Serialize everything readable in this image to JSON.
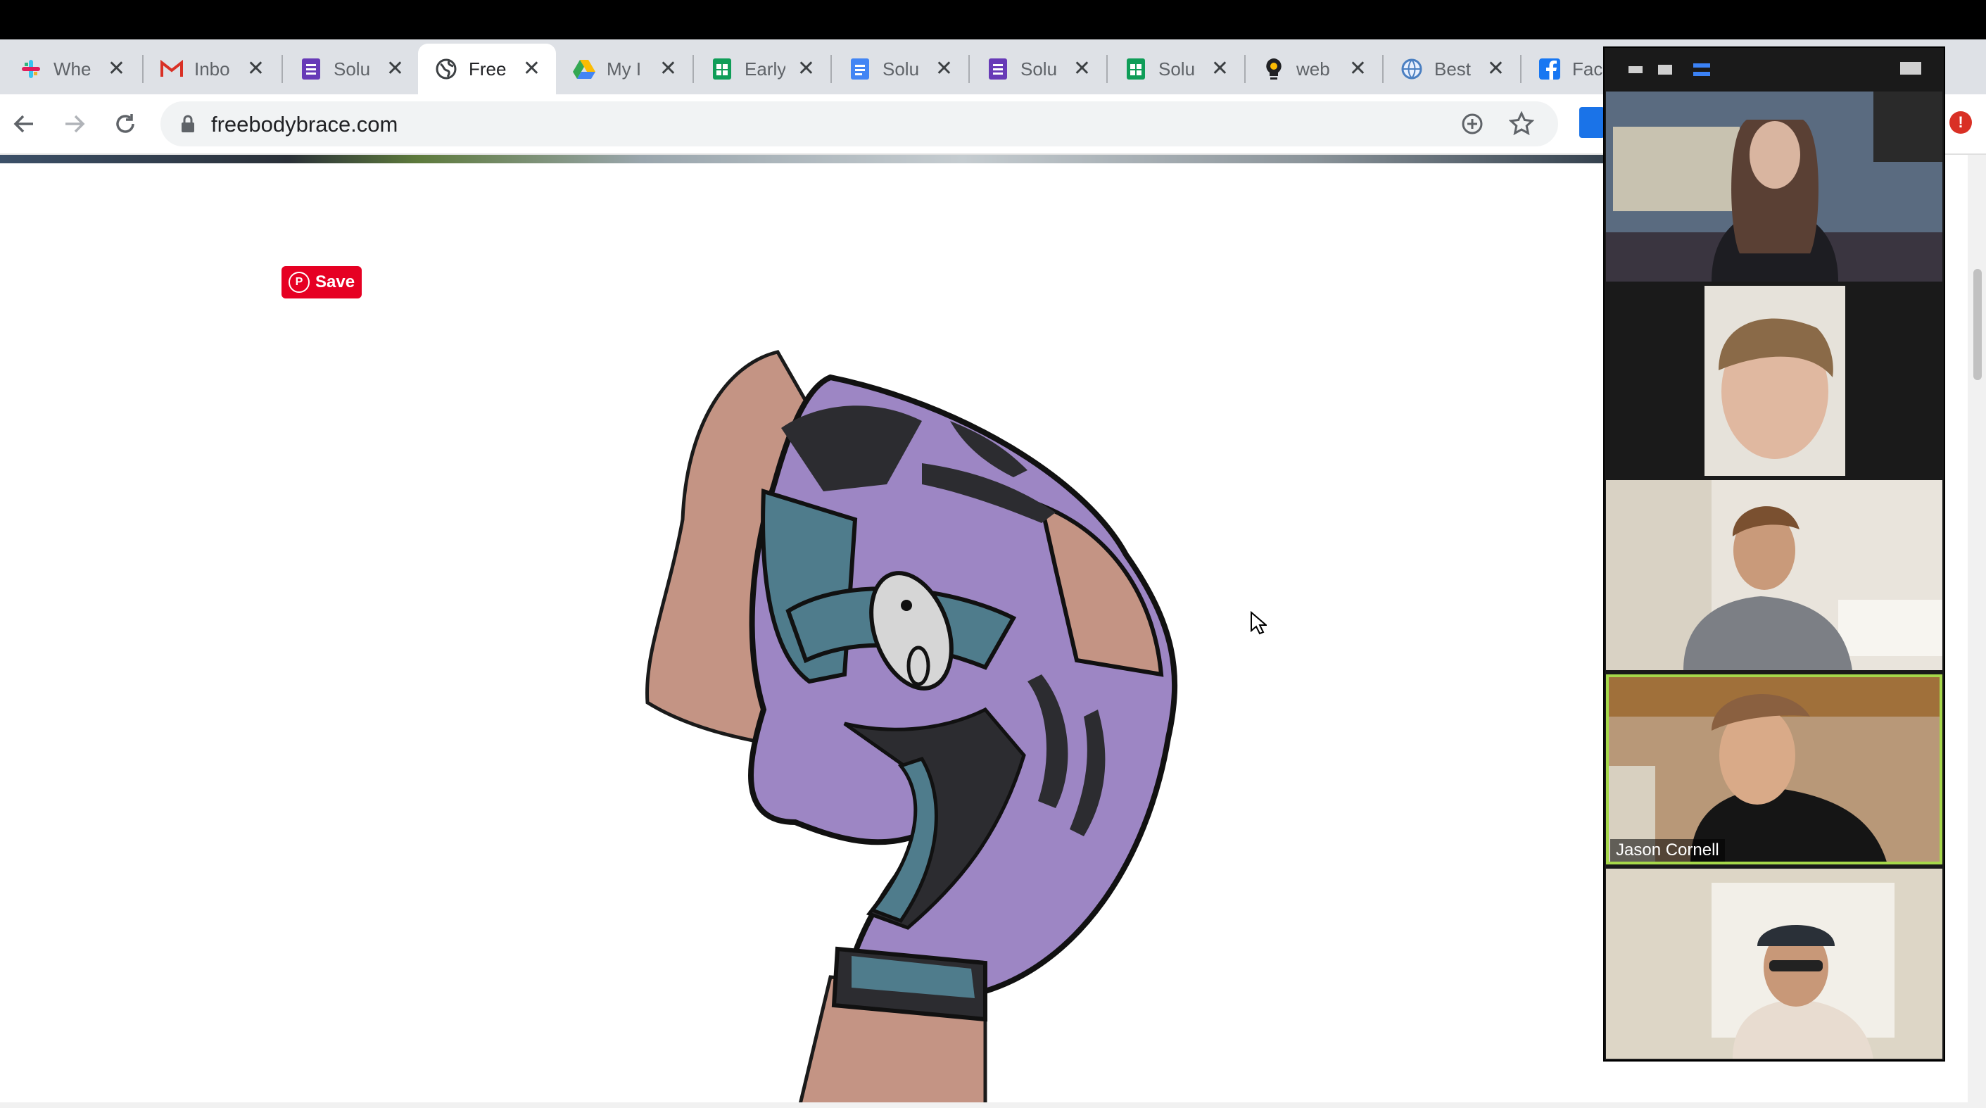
{
  "browser": {
    "tabs": [
      {
        "label": "Whe",
        "icon": "slack-icon"
      },
      {
        "label": "Inbo",
        "icon": "gmail-icon"
      },
      {
        "label": "Solu",
        "icon": "forms-icon"
      },
      {
        "label": "Free",
        "icon": "globe-icon",
        "active": true
      },
      {
        "label": "My I",
        "icon": "drive-icon"
      },
      {
        "label": "Early",
        "icon": "sheets-icon"
      },
      {
        "label": "Solu",
        "icon": "docs-icon"
      },
      {
        "label": "Solu",
        "icon": "forms-icon"
      },
      {
        "label": "Solu",
        "icon": "sheets-icon"
      },
      {
        "label": "web",
        "icon": "lightbulb-icon"
      },
      {
        "label": "Best",
        "icon": "globe-icon"
      },
      {
        "label": "Face",
        "icon": "facebook-icon"
      }
    ],
    "url": "freebodybrace.com"
  },
  "page": {
    "save_label": "Save"
  },
  "zoom": {
    "active_speaker_name": "Jason Cornell"
  },
  "colors": {
    "brace_purple": "#9d86c4",
    "brace_teal": "#4f7c8c",
    "pinterest_red": "#e60023",
    "active_speaker_border": "#a6d84a"
  }
}
